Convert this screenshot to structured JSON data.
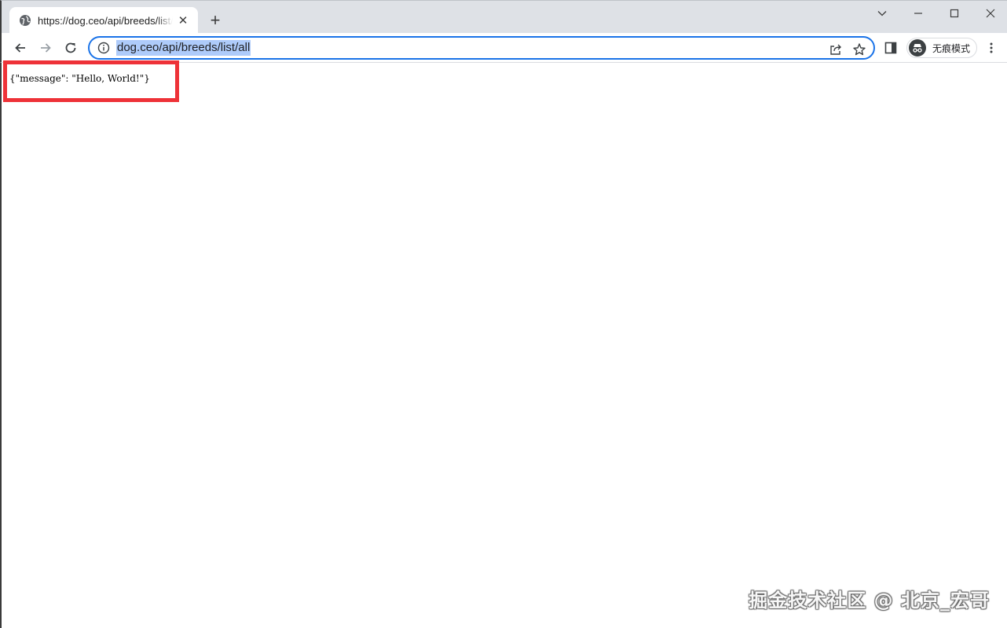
{
  "tab": {
    "title": "https://dog.ceo/api/breeds/list/all",
    "close_glyph": "✕",
    "favicon": "globe-icon"
  },
  "new_tab_glyph": "+",
  "window_controls": [
    "chevron-down-icon",
    "minimize-icon",
    "maximize-icon",
    "close-icon"
  ],
  "omnibox": {
    "url": "dog.ceo/api/breeds/list/all",
    "info_icon": "info-icon",
    "actions": [
      "share-icon",
      "star-icon"
    ]
  },
  "incognito": {
    "label": "无痕模式"
  },
  "page": {
    "body_text": "{\"message\": \"Hello, World!\"}"
  },
  "annotation": {
    "color": "#ee3238"
  },
  "watermark": "掘金技术社区 @ 北京_宏哥"
}
